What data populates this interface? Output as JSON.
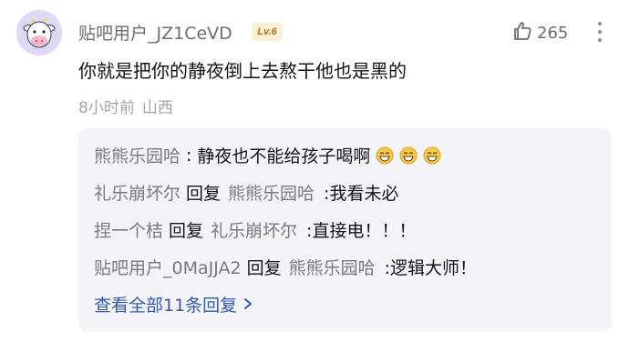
{
  "comment": {
    "username": "贴吧用户_JZ1CeVD",
    "level": "Lv.6",
    "like_count": "265",
    "text": "你就是把你的静夜倒上去熬干他也是黑的",
    "time": "8小时前",
    "location": "山西",
    "like_icon": "thumbs-up-icon",
    "more_icon": "more-vertical-icon"
  },
  "replies": [
    {
      "author": "熊熊乐园哈",
      "reply_word": "",
      "target": "",
      "text": "静夜也不能给孩子喝啊",
      "emojis": [
        "grin-emoji",
        "grin-emoji",
        "grin-emoji"
      ]
    },
    {
      "author": "礼乐崩坏尔",
      "reply_word": "回复",
      "target": "熊熊乐园哈",
      "text": ":我看未必"
    },
    {
      "author": "捏一个桔",
      "reply_word": "回复",
      "target": "礼乐崩坏尔",
      "text": ":直接电！！！"
    },
    {
      "author": "贴吧用户_0MaJJA2",
      "reply_word": "回复",
      "target": "熊熊乐园哈",
      "text": ":逻辑大师！"
    }
  ],
  "view_all": "查看全部11条回复",
  "colors": {
    "link": "#3558b0",
    "name": "#787880",
    "badge_bg": "#fbf0d5",
    "badge_text": "#a8731b"
  }
}
